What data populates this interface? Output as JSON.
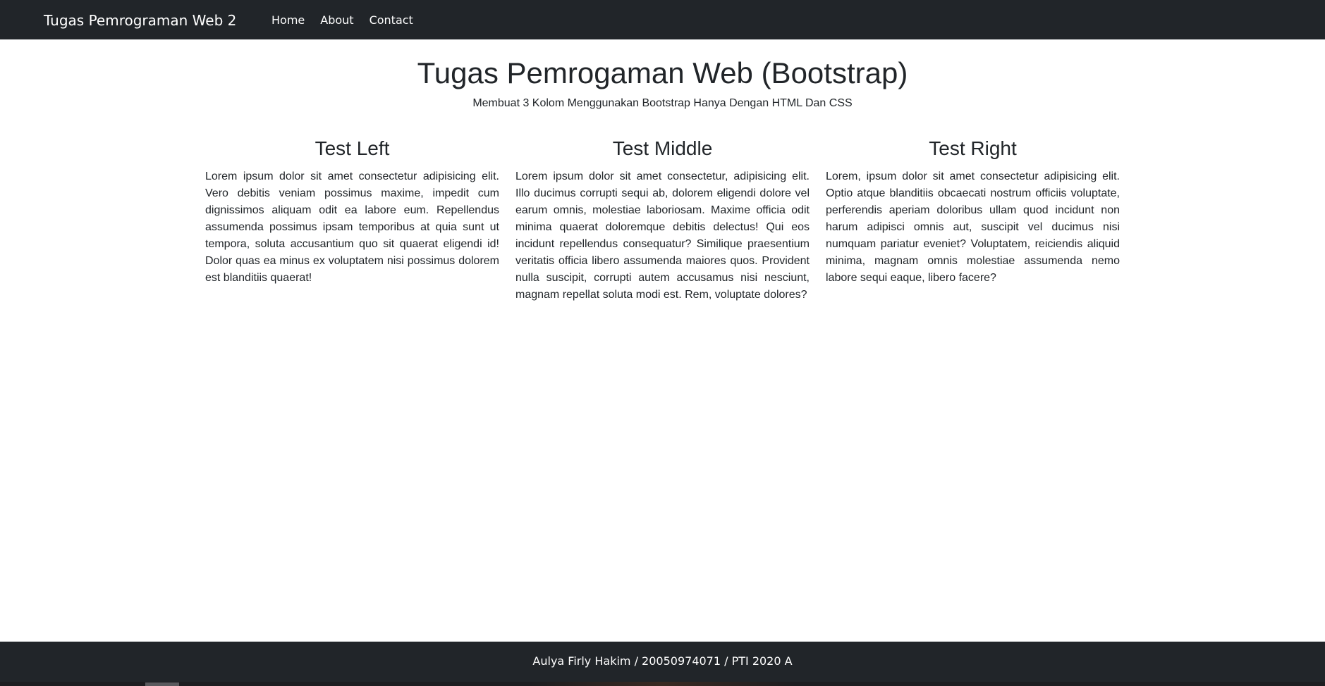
{
  "navbar": {
    "brand": "Tugas Pemrograman Web 2",
    "links": [
      "Home",
      "About",
      "Contact"
    ]
  },
  "header": {
    "title": "Tugas Pemrogaman Web (Bootstrap)",
    "subtitle": "Membuat 3 Kolom Menggunakan Bootstrap Hanya Dengan HTML Dan CSS"
  },
  "columns": [
    {
      "heading": "Test Left",
      "text": "Lorem ipsum dolor sit amet consectetur adipisicing elit. Vero debitis veniam possimus maxime, impedit cum dignissimos aliquam odit ea labore eum. Repellendus assumenda possimus ipsam temporibus at quia sunt ut tempora, soluta accusantium quo sit quaerat eligendi id! Dolor quas ea minus ex voluptatem nisi possimus dolorem est blanditiis quaerat!"
    },
    {
      "heading": "Test Middle",
      "text": "Lorem ipsum dolor sit amet consectetur, adipisicing elit. Illo ducimus corrupti sequi ab, dolorem eligendi dolore vel earum omnis, molestiae laboriosam. Maxime officia odit minima quaerat doloremque debitis delectus! Qui eos incidunt repellendus consequatur? Similique praesentium veritatis officia libero assumenda maiores quos. Provident nulla suscipit, corrupti autem accusamus nisi nesciunt, magnam repellat soluta modi est. Rem, voluptate dolores?"
    },
    {
      "heading": "Test Right",
      "text": "Lorem, ipsum dolor sit amet consectetur adipisicing elit. Optio atque blanditiis obcaecati nostrum officiis voluptate, perferendis aperiam doloribus ullam quod incidunt non harum adipisci omnis aut, suscipit vel ducimus nisi numquam pariatur eveniet? Voluptatem, reiciendis aliquid minima, magnam omnis molestiae assumenda nemo labore sequi eaque, libero facere?"
    }
  ],
  "footer": {
    "text": "Aulya Firly Hakim / 20050974071 / PTI 2020 A"
  },
  "colors": {
    "navbar_bg": "#212529",
    "footer_bg": "#212529",
    "text": "#212529",
    "nav_text": "#ffffff"
  }
}
